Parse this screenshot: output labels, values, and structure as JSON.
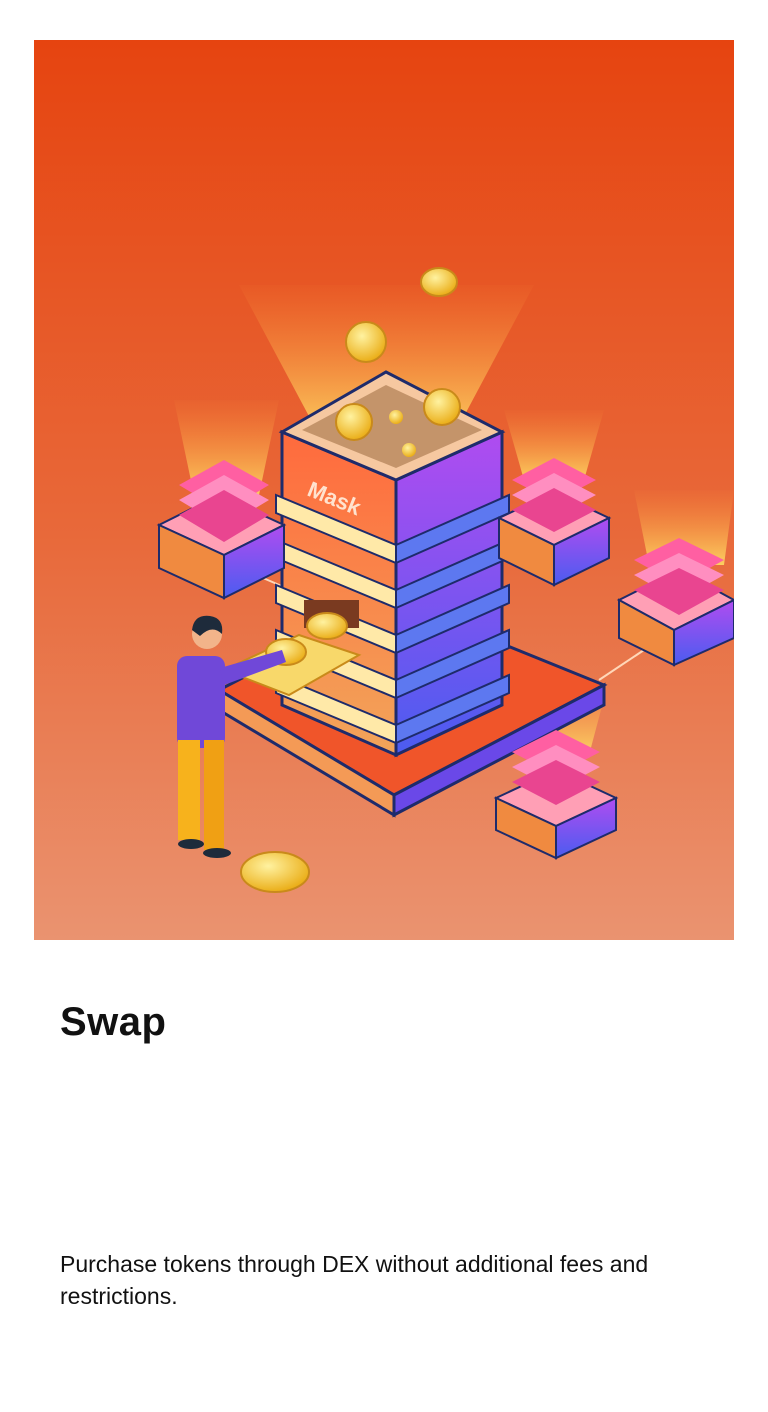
{
  "onboarding": {
    "title": "Swap",
    "description": "Purchase tokens through DEX without additional fees and restrictions.",
    "illustration": {
      "brand_label": "Mask",
      "colors": {
        "top": "#e64410",
        "bottom": "#ea9370",
        "accent_pink": "#ff5fa2",
        "accent_purple": "#8a4cf0",
        "coin": "#f6c431"
      }
    }
  }
}
